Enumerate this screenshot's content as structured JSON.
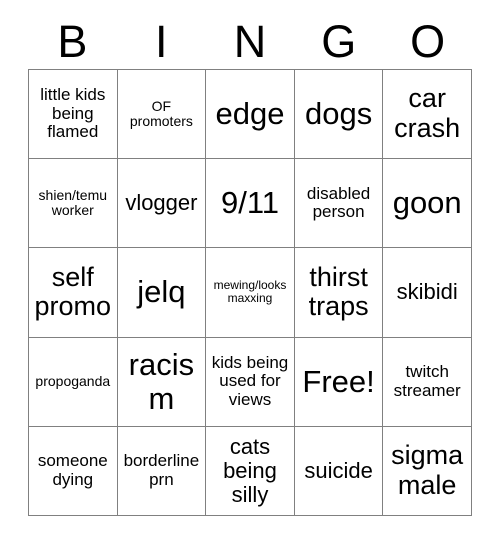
{
  "card": {
    "header_letters": [
      "B",
      "I",
      "N",
      "G",
      "O"
    ],
    "rows": [
      [
        {
          "text": "little kids being flamed",
          "size": "md"
        },
        {
          "text": "OF promoters",
          "size": "sm"
        },
        {
          "text": "edge",
          "size": "xxl"
        },
        {
          "text": "dogs",
          "size": "xxl"
        },
        {
          "text": "car crash",
          "size": "xl"
        }
      ],
      [
        {
          "text": "shien/temu worker",
          "size": "sm"
        },
        {
          "text": "vlogger",
          "size": "lg"
        },
        {
          "text": "9/11",
          "size": "xxl"
        },
        {
          "text": "disabled person",
          "size": "md"
        },
        {
          "text": "goon",
          "size": "xxl"
        }
      ],
      [
        {
          "text": "self promo",
          "size": "xl"
        },
        {
          "text": "jelq",
          "size": "xxl"
        },
        {
          "text": "mewing/looksmaxxing",
          "size": "xs"
        },
        {
          "text": "thirst traps",
          "size": "xl"
        },
        {
          "text": "skibidi",
          "size": "lg"
        }
      ],
      [
        {
          "text": "propoganda",
          "size": "sm"
        },
        {
          "text": "racism",
          "size": "xxl"
        },
        {
          "text": "kids being used for views",
          "size": "md"
        },
        {
          "text": "Free!",
          "size": "xxl"
        },
        {
          "text": "twitch streamer",
          "size": "md"
        }
      ],
      [
        {
          "text": "someone dying",
          "size": "md"
        },
        {
          "text": "borderline prn",
          "size": "md"
        },
        {
          "text": "cats being silly",
          "size": "lg"
        },
        {
          "text": "suicide",
          "size": "lg"
        },
        {
          "text": "sigma male",
          "size": "xl"
        }
      ]
    ]
  }
}
